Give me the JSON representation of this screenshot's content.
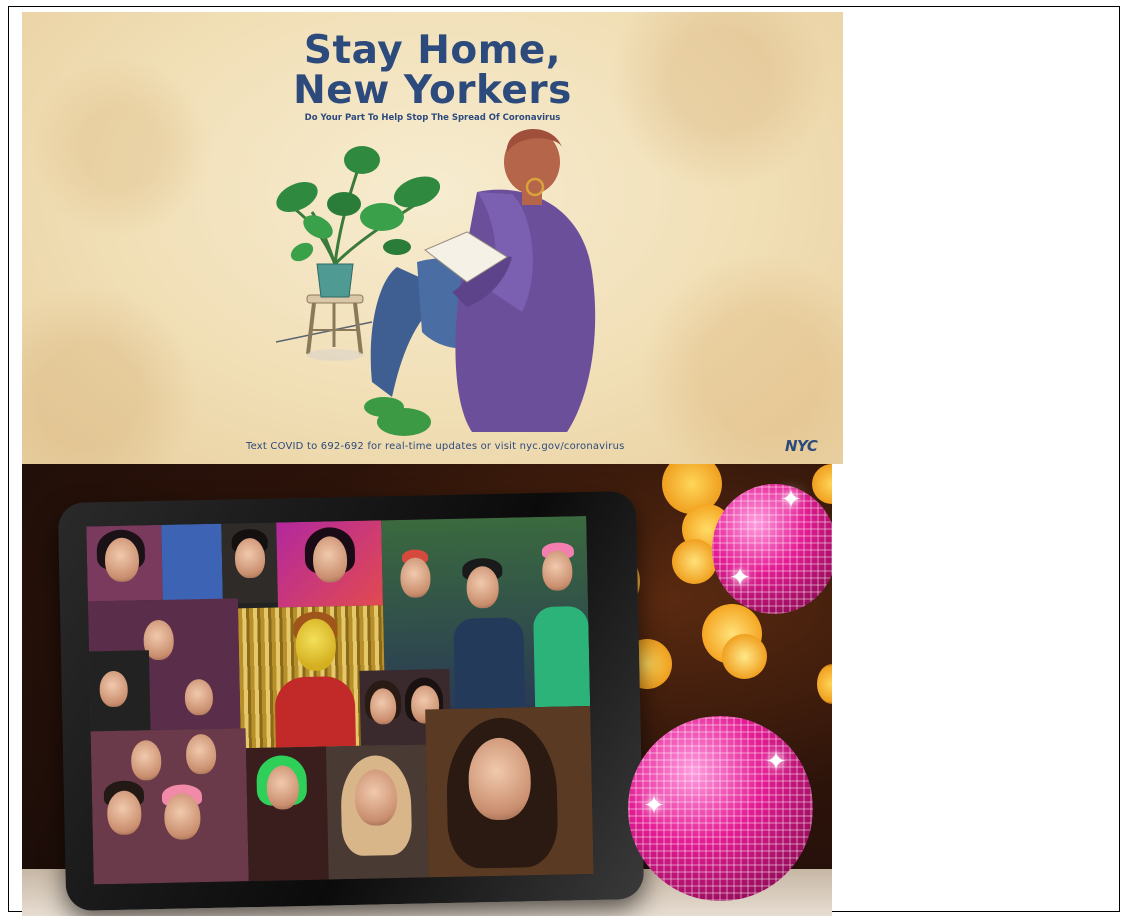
{
  "poster": {
    "title_line1": "Stay Home,",
    "title_line2": "New Yorkers",
    "subtitle": "Do Your Part To Help Stop The Spread Of Coronavirus",
    "footer": "Text COVID to 692-692 for real-time updates or visit nyc.gov/coronavirus",
    "logo_text": "NYC",
    "colors": {
      "text": "#2c4a7c",
      "background": "#f1dfb6"
    }
  },
  "photo": {
    "colors": {
      "disco": "#e41c94",
      "bokeh": "#ffb629"
    },
    "icons": [
      "disco-ball",
      "sparkle",
      "tablet"
    ]
  }
}
